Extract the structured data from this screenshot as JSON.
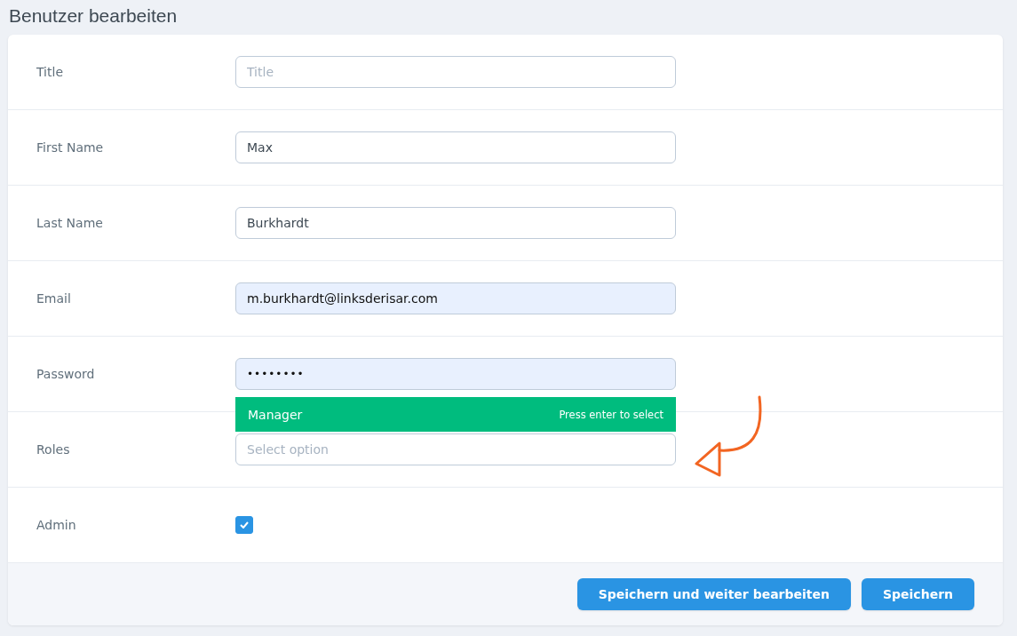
{
  "page": {
    "title": "Benutzer bearbeiten"
  },
  "fields": [
    {
      "kind": "text",
      "label": "Title",
      "placeholder": "Title",
      "autofilled": false
    },
    {
      "kind": "text",
      "label": "First Name",
      "value": "Max",
      "autofilled": false
    },
    {
      "kind": "text",
      "label": "Last Name",
      "value": "Burkhardt",
      "autofilled": false
    },
    {
      "kind": "text",
      "label": "Email",
      "value": "m.burkhardt@linksderisar.com",
      "autofilled": true
    },
    {
      "kind": "password",
      "label": "Password",
      "value": "••••••••",
      "autofilled": true
    },
    {
      "kind": "select",
      "label": "Roles",
      "placeholder": "Select option",
      "options": [
        {
          "label": "Manager",
          "hint": "Press enter to select",
          "highlighted": true
        }
      ]
    },
    {
      "kind": "checkbox",
      "label": "Admin",
      "checked": true
    }
  ],
  "buttons": [
    "Speichern und weiter bearbeiten",
    "Speichern"
  ]
}
